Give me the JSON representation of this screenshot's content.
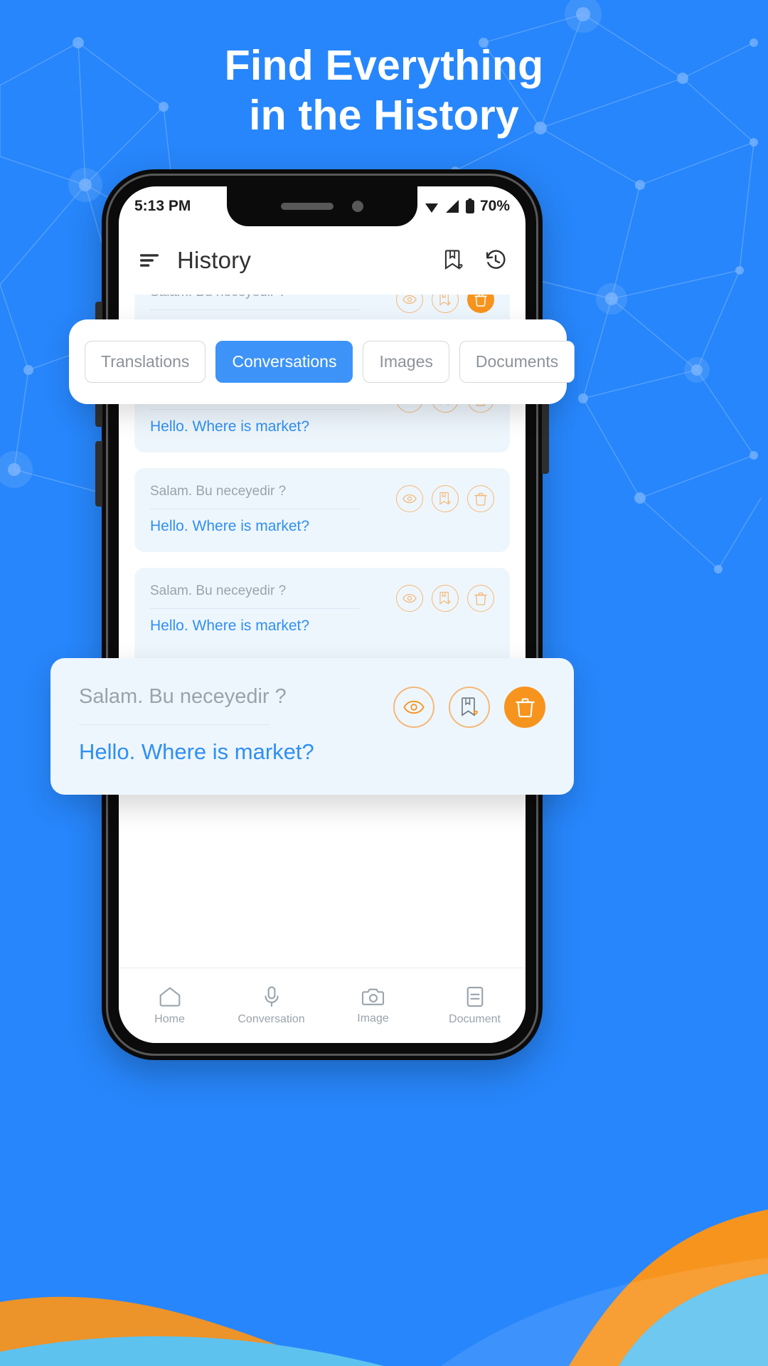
{
  "promo": {
    "headline_line1": "Find Everything",
    "headline_line2": "in the History",
    "background_color": "#2786fb",
    "accent_orange": "#f7941e",
    "accent_blue": "#3d93f8"
  },
  "statusbar": {
    "time": "5:13 PM",
    "battery_percent": "70%",
    "icons": [
      "signal-icon",
      "wifi-icon",
      "battery-icon"
    ]
  },
  "appbar": {
    "menu_icon": "sort-menu-icon",
    "title": "History",
    "actions": [
      {
        "name": "saved-bookmark-icon"
      },
      {
        "name": "history-clock-icon"
      }
    ]
  },
  "filters": {
    "chips": [
      {
        "label": "Translations",
        "active": false
      },
      {
        "label": "Conversations",
        "active": true
      },
      {
        "label": "Images",
        "active": false
      },
      {
        "label": "Documents",
        "active": false
      }
    ]
  },
  "history": {
    "items": [
      {
        "source": "Salam. Bu neceyedir ?",
        "target": "Hello. Where is market?"
      },
      {
        "source": "Salam. Bu neceyedir ?",
        "target": "Hello. Where is market?"
      },
      {
        "source": "Salam. Bu neceyedir ?",
        "target": "Hello. Where is market?"
      },
      {
        "source": "Salam. Bu neceyedir ?",
        "target": "Hello. Where is market?"
      },
      {
        "source": "Salam. Bu neceyedir ?",
        "target": "Hello. Where is market?"
      }
    ],
    "row_actions": [
      {
        "name": "view-eye-icon",
        "style": "outline"
      },
      {
        "name": "save-bookmark-heart-icon",
        "style": "outline"
      },
      {
        "name": "delete-trash-icon",
        "style": "solid"
      }
    ]
  },
  "featured_card": {
    "source": "Salam. Bu neceyedir ?",
    "target": "Hello. Where is market?"
  },
  "bottomnav": {
    "items": [
      {
        "label": "Home",
        "icon": "home-icon"
      },
      {
        "label": "Conversation",
        "icon": "microphone-icon"
      },
      {
        "label": "Image",
        "icon": "camera-icon"
      },
      {
        "label": "Document",
        "icon": "document-icon"
      }
    ]
  }
}
